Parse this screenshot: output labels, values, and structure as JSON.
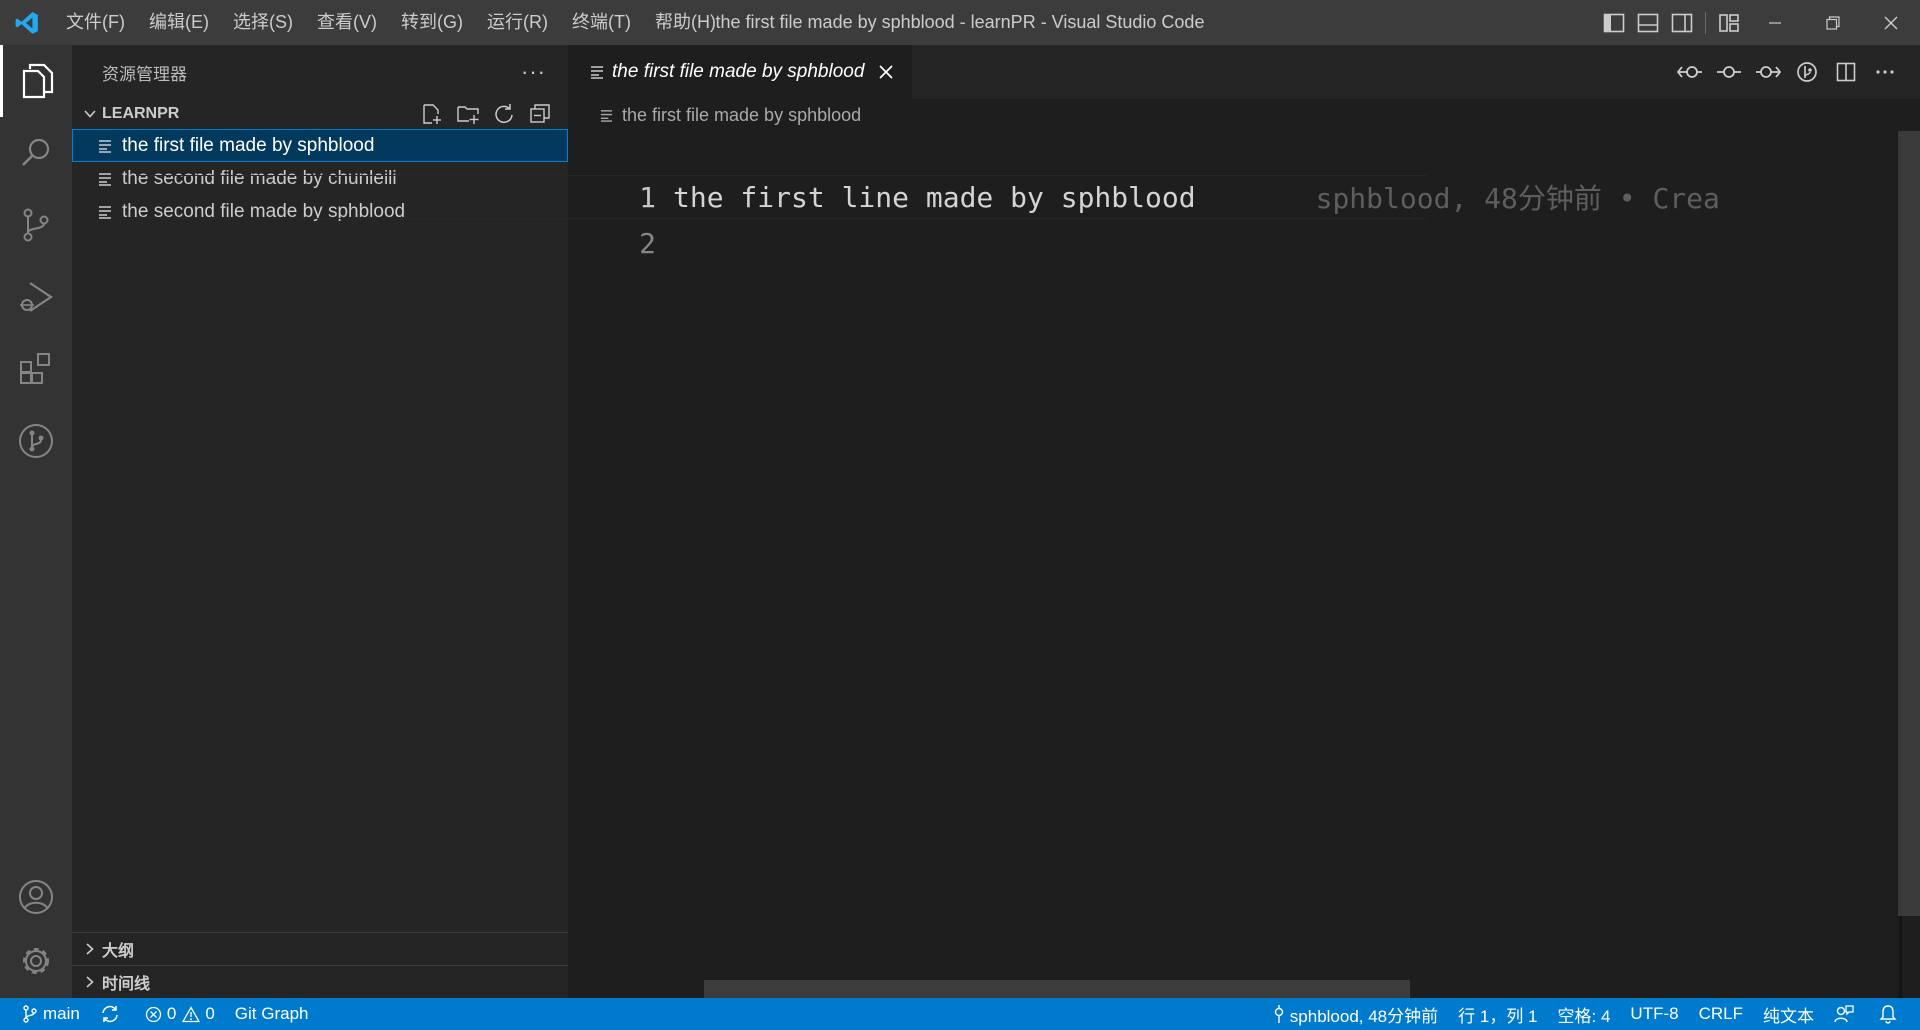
{
  "titlebar": {
    "title": "the first file made by sphblood - learnPR - Visual Studio Code",
    "menu": [
      "文件(F)",
      "编辑(E)",
      "选择(S)",
      "查看(V)",
      "转到(G)",
      "运行(R)",
      "终端(T)",
      "帮助(H)"
    ]
  },
  "sidebar": {
    "header": "资源管理器",
    "more": "···",
    "folder": "LEARNPR",
    "files": [
      "the first file made by sphblood",
      "the second file made by chunleili",
      "the second file made by sphblood"
    ],
    "outline": "大纲",
    "timeline": "时间线"
  },
  "editor": {
    "tab_label": "the first file made by sphblood",
    "breadcrumb": "the first file made by sphblood",
    "lines": [
      {
        "number": "1",
        "text": "the first line made by sphblood",
        "blame": "sphblood, 48分钟前 • Crea"
      },
      {
        "number": "2",
        "text": ""
      }
    ]
  },
  "statusbar": {
    "branch": "main",
    "errors": "0",
    "warnings": "0",
    "git_graph": "Git Graph",
    "blame": "sphblood, 48分钟前",
    "position": "行 1，列 1",
    "spaces": "空格: 4",
    "encoding": "UTF-8",
    "eol": "CRLF",
    "language": "纯文本"
  },
  "colors": {
    "accent": "#007acc",
    "selection": "#04395e",
    "logo": "#23a9f2"
  }
}
